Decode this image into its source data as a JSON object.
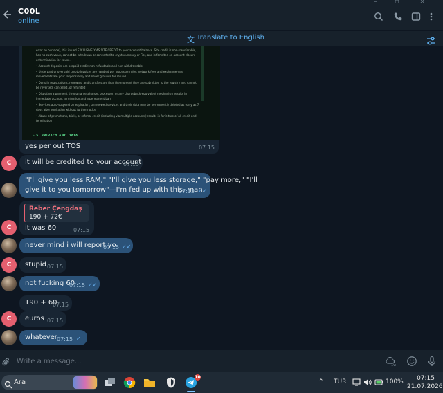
{
  "header": {
    "title": "C00L",
    "status": "online"
  },
  "translate_bar": {
    "label": "Translate to English"
  },
  "screenshot_text": {
    "lines": [
      "error on our side), it is issued EXCLUSIVELY AS SITE CREDIT to your account balance. Site credit is non-transferable,",
      "has no cash value, cannot be withdrawn or converted to cryptocurrency or Fiat, and is forfeited on account closure",
      "or termination for cause.",
      "• Account deposits are prepaid credit: non-refundable and non-withdrawable",
      "• Underpaid or overpaid crypto invoices are handled per processor rules; network fees and exchange-rate",
      "movements are your responsibility and never grounds for refund",
      "• Domain registrations, renewals, and transfers are final the moment they are submitted to the registry and cannot",
      "be reversed, cancelled, or refunded",
      "• Disputing a payment through an exchange, processor, or any chargeback-equivalent mechanism results in",
      "immediate account termination and a permanent ban",
      "• Services auto-suspend on expiration; unrenewed services and their data may be permanently deleted as early as 7",
      "days after expiration without further notice",
      "• Abuse of promotions, trials, or referral credit (including via multiple accounts) results in forfeiture of all credit and",
      "termination"
    ],
    "section_heading": "› 5. PRIVACY AND DATA"
  },
  "messages": [
    {
      "id": "m0",
      "dir": "in",
      "text": "yes per out TOS",
      "time": "07:15"
    },
    {
      "id": "m1",
      "dir": "in",
      "text": "it will be credited to your account",
      "time": "07:15",
      "avatar": "C"
    },
    {
      "id": "m2",
      "dir": "out",
      "text_line1": "\"I'll give you less RAM,\" \"I'll give you less storage,\" \"pay more,\" \"I'll",
      "text_line2": "give it to you tomorrow\"—I'm fed up with this, man.",
      "time": "07:15"
    },
    {
      "id": "m3",
      "dir": "in",
      "reply_name": "Reber Çengdaş",
      "reply_text": "190 + 72€",
      "text": "it was 60",
      "time": "07:15",
      "avatar": "C"
    },
    {
      "id": "m4",
      "dir": "out",
      "text": "never mind i will report yo",
      "time": "07:15"
    },
    {
      "id": "m5",
      "dir": "in",
      "text": "stupid",
      "time": "07:15",
      "avatar": "C"
    },
    {
      "id": "m6",
      "dir": "out",
      "text": "not fucking 60",
      "time": "07:15"
    },
    {
      "id": "m7",
      "dir": "in",
      "text": "190 + 60",
      "time": "07:15"
    },
    {
      "id": "m8",
      "dir": "in",
      "text": "euros",
      "time": "07:15",
      "avatar": "C"
    },
    {
      "id": "m9",
      "dir": "out",
      "text": "whatever",
      "time": "07:15"
    }
  ],
  "composer": {
    "placeholder": "Write a message..."
  },
  "taskbar": {
    "search_label": "Ara",
    "telegram_badge": "10",
    "language": "TUR",
    "battery": "100%",
    "time": "07:15",
    "date": "21.07.2026"
  },
  "colors": {
    "accent": "#5fb1ef",
    "outgoing_bubble": "#2b5278",
    "incoming_bubble": "#182533",
    "avatar_c": "#e45f6f"
  }
}
